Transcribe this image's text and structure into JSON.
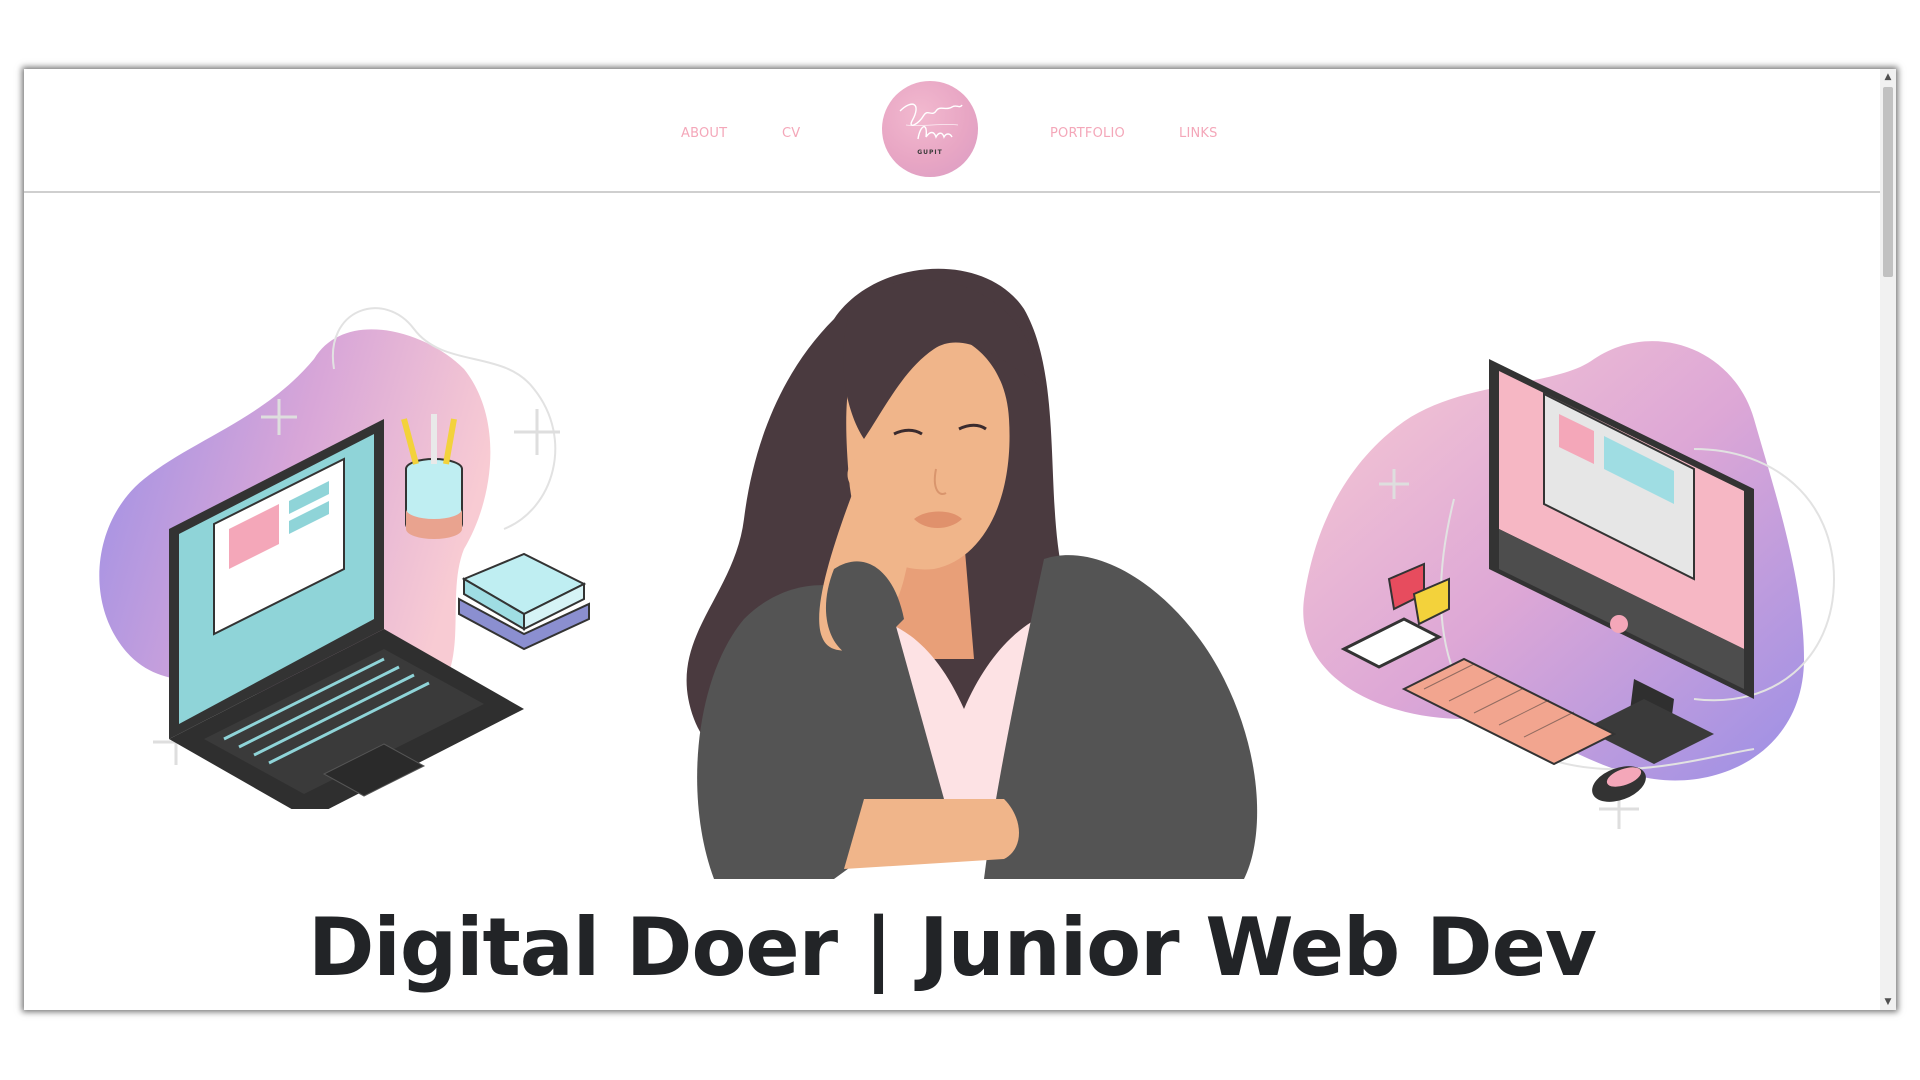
{
  "nav": {
    "left": [
      {
        "label": "ABOUT"
      },
      {
        "label": "CV"
      }
    ],
    "right": [
      {
        "label": "PORTFOLIO"
      },
      {
        "label": "LINKS"
      }
    ]
  },
  "logo": {
    "script_text": "Beverly Ann",
    "sub_text": "GUPIT"
  },
  "hero": {
    "title": "Digital Doer | Junior Web Dev"
  },
  "colors": {
    "nav_link": "#f4a7b9",
    "title": "#222427",
    "blob_purple": "#9b8fe6",
    "blob_pink": "#f6c6d1",
    "jacket": "#545454",
    "skin": "#f0b58a",
    "hair": "#4a3a3f"
  },
  "icons": {
    "scroll_up": "triangle-up-icon",
    "scroll_down": "triangle-down-icon"
  }
}
